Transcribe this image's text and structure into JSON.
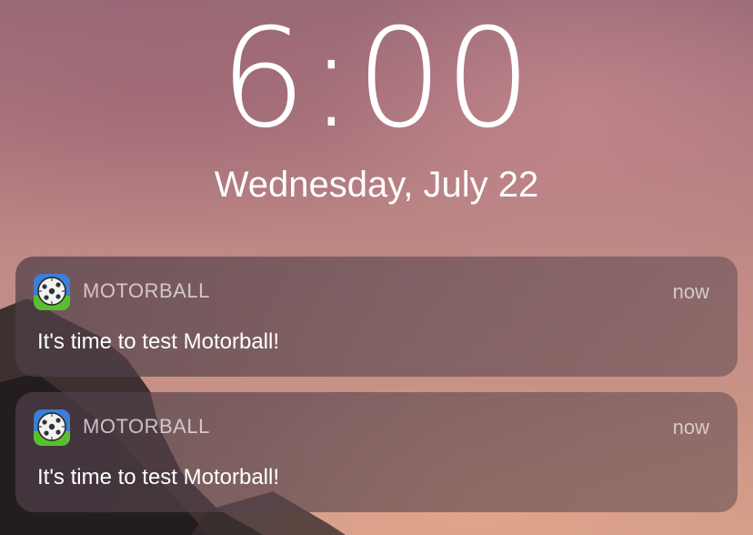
{
  "lock_screen": {
    "time": "6:00",
    "date": "Wednesday, July 22"
  },
  "notifications": [
    {
      "app_name": "MOTORBALL",
      "time": "now",
      "message": "It's time to test Motorball!",
      "icon": "motorball-app-icon"
    },
    {
      "app_name": "MOTORBALL",
      "time": "now",
      "message": "It's time to test Motorball!",
      "icon": "motorball-app-icon"
    }
  ],
  "colors": {
    "notification_background": "#4e3e48",
    "icon_sky": "#3b7fd6",
    "icon_grass": "#58c030"
  }
}
